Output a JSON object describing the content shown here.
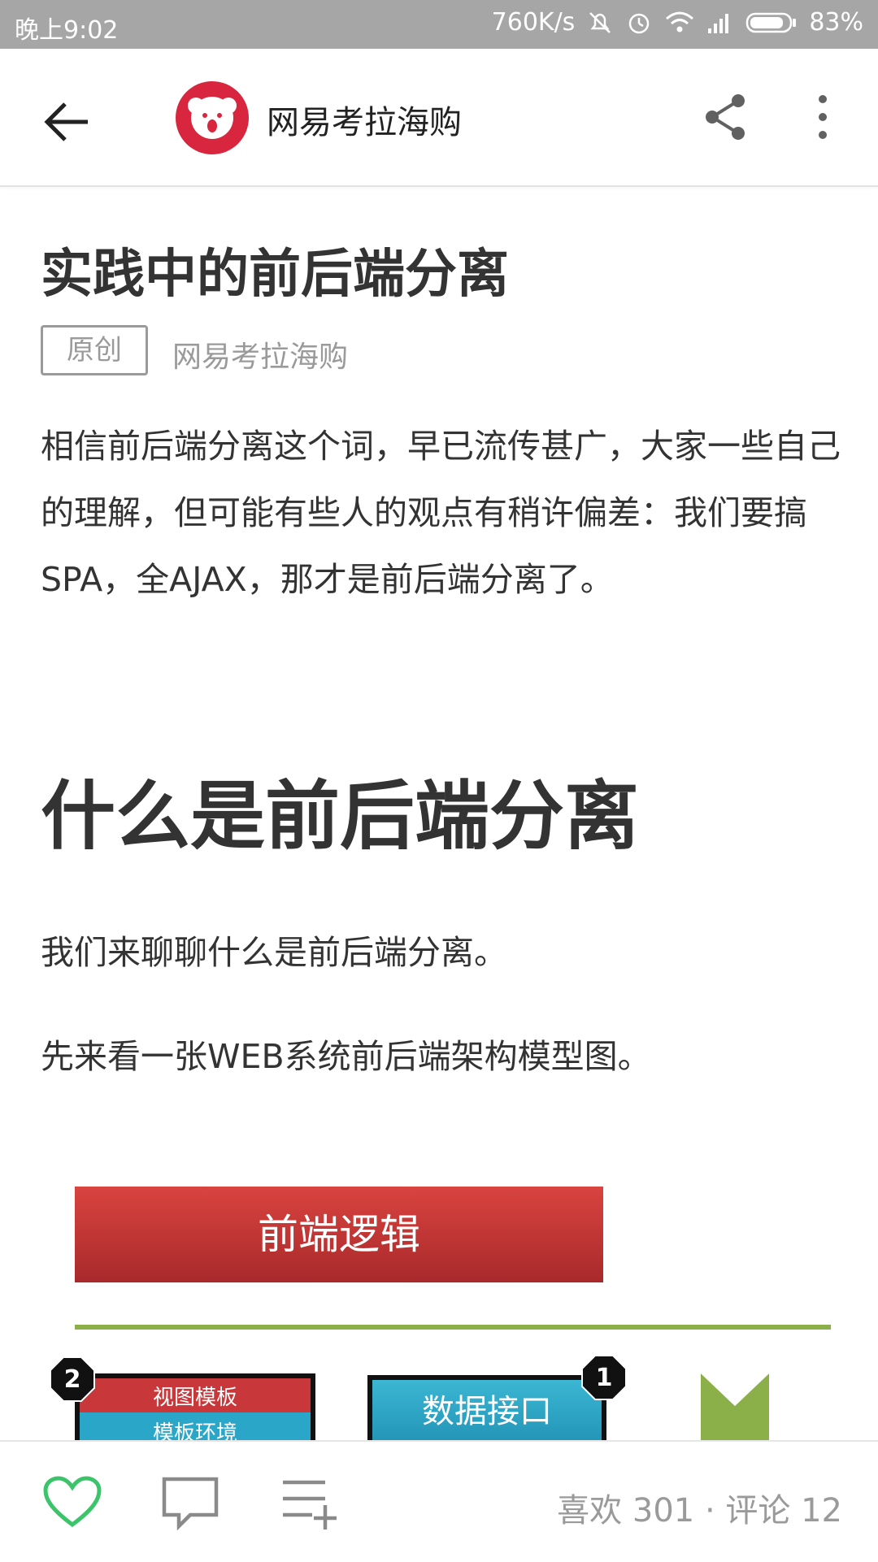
{
  "status_bar": {
    "time": "晚上9:02",
    "network_speed": "760K/s",
    "battery": "83%",
    "icons": [
      "mute-icon",
      "alarm-icon",
      "wifi-icon",
      "signal-icon",
      "battery-icon"
    ]
  },
  "app_bar": {
    "account_name": "网易考拉海购",
    "icons": [
      "back-arrow-icon",
      "koala-logo",
      "share-icon",
      "more-vert-icon"
    ]
  },
  "article": {
    "title": "实践中的前后端分离",
    "badge": "原创",
    "author": "网易考拉海购",
    "intro": "相信前后端分离这个词，早已流传甚广，大家一些自己的理解，但可能有些人的观点有稍许偏差：我们要搞 SPA，全AJAX，那才是前后端分离了。",
    "heading": "什么是前后端分离",
    "para1": "我们来聊聊什么是前后端分离。",
    "para2": "先来看一张WEB系统前后端架构模型图。"
  },
  "diagram": {
    "top_box": "前端逻辑",
    "badge_left": "2",
    "left_row1": "视图模板",
    "left_row2": "模板环境",
    "badge_right": "1",
    "middle_box": "数据接口",
    "colors": {
      "red": "#c8383a",
      "blue": "#2aa7c8",
      "green": "#8bb04a",
      "black": "#111111"
    }
  },
  "bottom_bar": {
    "stats": "喜欢 301 · 评论 12",
    "icons": [
      "heart-icon",
      "comment-icon",
      "add-to-list-icon"
    ],
    "accent": "#3cc46a"
  }
}
